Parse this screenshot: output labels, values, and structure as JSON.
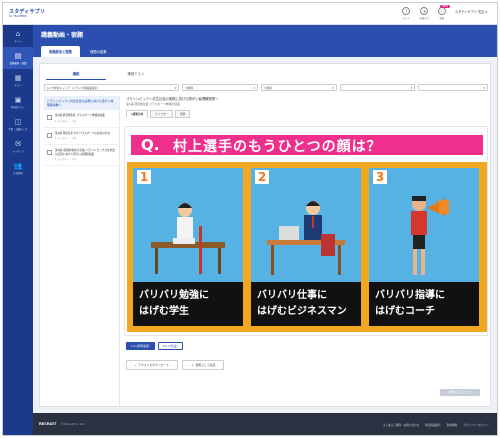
{
  "header": {
    "logo_main": "スタディサプリ",
    "logo_sub": "for TEACHERS",
    "icons": [
      {
        "name": "guide",
        "label": "ガイド"
      },
      {
        "name": "news",
        "label": "お知らせ"
      },
      {
        "name": "new",
        "label": "新着"
      }
    ],
    "new_badge": "NEW",
    "user": "スタディサプリ 先生 ▾"
  },
  "sidebar": {
    "items": [
      {
        "icon": "⌂",
        "label": "ホーム"
      },
      {
        "icon": "▤",
        "label": "講義動画・宿題"
      },
      {
        "icon": "▦",
        "label": "テスト"
      },
      {
        "icon": "▣",
        "label": "到達度テスト"
      },
      {
        "icon": "◫",
        "label": "学習・成績データ"
      },
      {
        "icon": "✉",
        "label": "メッセージ"
      },
      {
        "icon": "👥",
        "label": "生徒管理"
      }
    ]
  },
  "page": {
    "title": "講義動画・宿題",
    "tabs": [
      "宿題配信と閲覧",
      "宿題の結果"
    ]
  },
  "content": {
    "tabs": [
      "講座",
      "確認テスト"
    ],
    "filters": [
      {
        "value": "11 学年別キャリア（バランス型職業探索）",
        "placeholder": ""
      },
      {
        "value": "全教科",
        "placeholder": ""
      },
      {
        "value": "全教科",
        "placeholder": ""
      },
      {
        "value": "",
        "placeholder": ""
      },
      {
        "value": "",
        "placeholder": ""
      }
    ],
    "list_header": "パラリンピック〜共生社会の実現に向けた障がい者理解授業〜",
    "list": [
      {
        "text": "第1講 部活動生徒 パラスポーツ体験前授業",
        "meta": "1 チャプター ・ 3分"
      },
      {
        "text": "第2講 普段気をつけ パラスポーツの先生の方法",
        "meta": "1 チャプター ・ 4分"
      },
      {
        "text": "第3講 (受講対象者の家族) パラリンピック共生社会の実現に向けた障がい者理解授業",
        "meta": "1 チャプター ・ 8分"
      }
    ],
    "lecture_title": "パラリンピック〜共生社会の実現に向けた障がい者理解授業〜",
    "lecture_sub": "第1講 部活動生徒 パラスポーツ体験の授業",
    "video_tabs": [
      "1講義全体",
      "チャプター",
      "問題"
    ],
    "quiz": {
      "mark": "Q.",
      "question": "村上選手のもうひとつの顔は？",
      "options": [
        {
          "num": "1",
          "caption_l1": "バリバリ勉強に",
          "caption_l2": "はげむ学生"
        },
        {
          "num": "2",
          "caption_l1": "バリバリ仕事に",
          "caption_l2": "はげむビジネスマン"
        },
        {
          "num": "3",
          "caption_l1": "バリバリ指導に",
          "caption_l2": "はげむコーチ"
        }
      ]
    },
    "speed_buttons": [
      "1.0 (標準速度)",
      "2.0 (2倍速)"
    ],
    "action_buttons": [
      "テキストをダウンロード",
      "閲覧として追加"
    ],
    "complete_button": "視聴を完了にする"
  },
  "footer": {
    "logo": "RECRUIT",
    "copyright": "© Recruit Co., Ltd.",
    "links": [
      "よくあるご質問・お問い合わせ",
      "特定授業報告",
      "利用規約",
      "プライバシーポリシー"
    ]
  }
}
